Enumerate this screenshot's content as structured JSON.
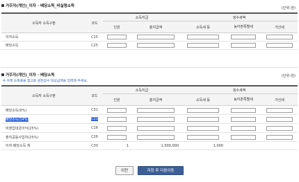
{
  "section1": {
    "title": "거주자(개인)_이자 · 배당소득_비실명소득",
    "unit": "(단위:원)",
    "col_type": "소득자 소득구분",
    "col_code": "코드",
    "group_income": "소득지급",
    "group_tax": "징수세액",
    "col_count": "인원",
    "col_total": "총지급액",
    "col_income_tax": "소득세 등",
    "col_rural_tax": "농어촌특별세",
    "col_addtax": "가산세",
    "rows": [
      {
        "label": "이자소득",
        "code": "C15"
      },
      {
        "label": "배당소득",
        "code": "C25"
      }
    ]
  },
  "section2": {
    "title": "거주자(개인)_이자 · 배당소득",
    "unit": "(단위:원)",
    "note": "※ 아래 소득률을 참고로 원천징수 대상금액을 입력해 주세요.",
    "col_type": "소득자 소득구분",
    "col_code": "코드",
    "group_income": "소득지급",
    "group_tax": "징수세액",
    "col_count": "인원",
    "col_total": "총지급액",
    "col_income_tax": "소득세 등",
    "col_rural_tax": "농어촌특별세",
    "col_addtax": "가산세",
    "rows": [
      {
        "label": "배당소득(9%)",
        "code": "C31"
      },
      {
        "label": "배당소득(14%)",
        "code": "C21"
      },
      {
        "label": "비영업대금이익(25%)",
        "code": "C16"
      },
      {
        "label": "출자공동사업자(25%)",
        "code": "C26"
      }
    ],
    "total_row": {
      "label": "이자·배당소득 계",
      "code": "C30",
      "count": "1",
      "total": "1,500,000",
      "income_tax": "1,000"
    }
  },
  "buttons": {
    "prev": "이전",
    "next": "저장 후 다음이동"
  },
  "colors": {
    "primary_button": "#3d5f95",
    "highlight": "#2f63d6",
    "note_text": "#2b5fb8"
  }
}
